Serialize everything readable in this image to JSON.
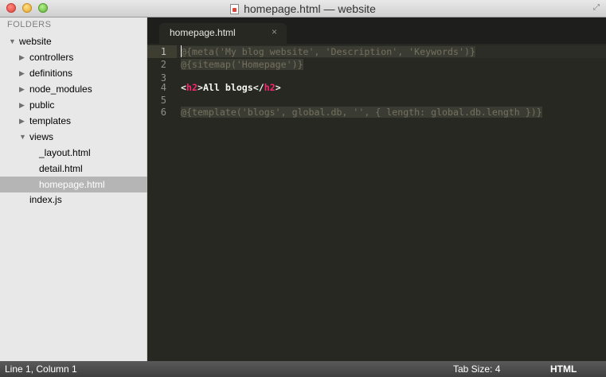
{
  "window": {
    "title": "homepage.html — website",
    "icons": {
      "doc": "html-document-icon",
      "fullscreen": "fullscreen-icon"
    }
  },
  "sidebar": {
    "header": "FOLDERS",
    "items": [
      {
        "label": "website",
        "expanded": true,
        "level": 0,
        "kind": "folder"
      },
      {
        "label": "controllers",
        "expanded": false,
        "level": 1,
        "kind": "folder"
      },
      {
        "label": "definitions",
        "expanded": false,
        "level": 1,
        "kind": "folder"
      },
      {
        "label": "node_modules",
        "expanded": false,
        "level": 1,
        "kind": "folder"
      },
      {
        "label": "public",
        "expanded": false,
        "level": 1,
        "kind": "folder"
      },
      {
        "label": "templates",
        "expanded": false,
        "level": 1,
        "kind": "folder"
      },
      {
        "label": "views",
        "expanded": true,
        "level": 1,
        "kind": "folder"
      },
      {
        "label": "_layout.html",
        "level": 2,
        "kind": "file"
      },
      {
        "label": "detail.html",
        "level": 2,
        "kind": "file"
      },
      {
        "label": "homepage.html",
        "level": 2,
        "kind": "file",
        "selected": true
      },
      {
        "label": "index.js",
        "level": 1,
        "kind": "file"
      }
    ]
  },
  "tabs": [
    {
      "label": "homepage.html",
      "close_glyph": "×",
      "active": true
    }
  ],
  "editor": {
    "active_line": 1,
    "line_numbers": [
      "1",
      "2",
      "3",
      "4",
      "5",
      "6"
    ],
    "lines": [
      "@{meta('My blog website', 'Description', 'Keywords')}",
      "@{sitemap('Homepage')}",
      "",
      "<h2>All blogs</h2>",
      "",
      "@{template('blogs', global.db, '', { length: global.db.length })}"
    ],
    "line4_parts": {
      "open_lt": "<",
      "open_tag": "h2",
      "open_gt": ">",
      "text": "All blogs",
      "close_lt": "</",
      "close_tag": "h2",
      "close_gt": ">"
    },
    "colors": {
      "background": "#272822",
      "tag": "#f92672",
      "comment": "#75715e",
      "text": "#f8f8f2"
    }
  },
  "statusbar": {
    "position": "Line 1, Column 1",
    "tab_size": "Tab Size: 4",
    "syntax": "HTML"
  }
}
